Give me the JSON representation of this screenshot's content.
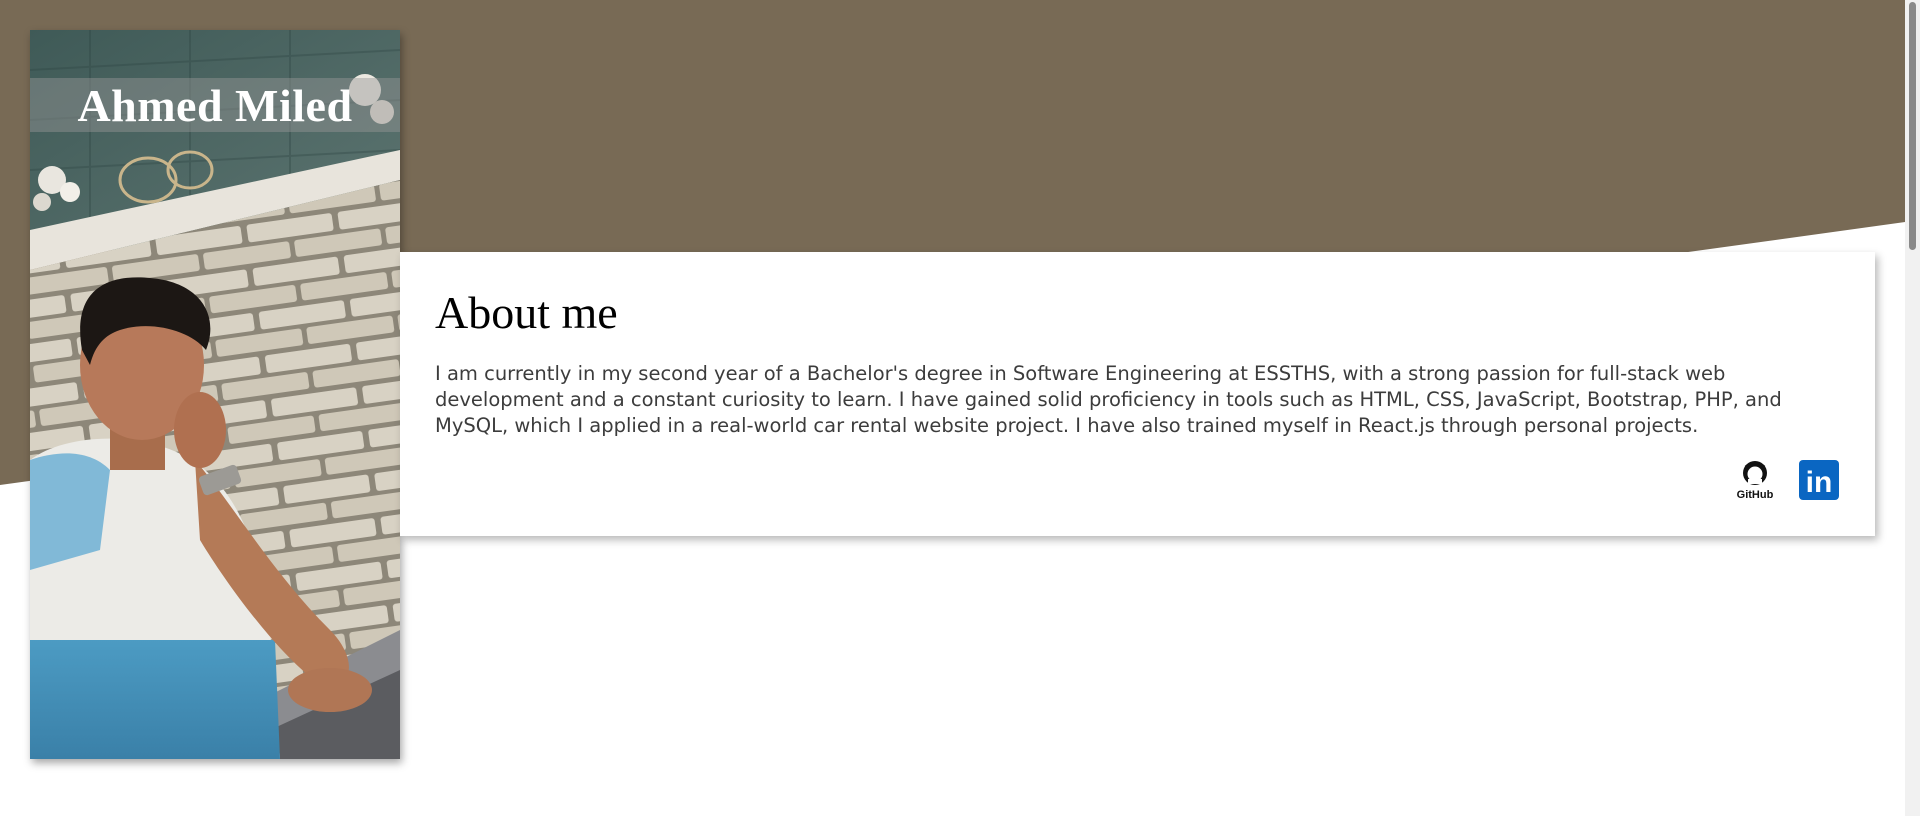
{
  "profile": {
    "name": "Ahmed Miled",
    "photo_icon": "profile-photo"
  },
  "about": {
    "title": "About me",
    "text": "I am currently in my second year of a Bachelor's degree in Software Engineering at ESSTHS, with a strong passion for full-stack web development and a constant curiosity to learn. I have gained solid proficiency in tools such as HTML, CSS, JavaScript, Bootstrap, PHP, and MySQL, which I applied in a real-world car rental website project. I have also trained myself in React.js through personal projects."
  },
  "social": {
    "github": {
      "icon": "github-icon",
      "label": "GitHub"
    },
    "linkedin": {
      "icon": "linkedin-icon",
      "label": "in"
    }
  },
  "colors": {
    "header_bg": "#786a55",
    "page_bg": "#ffffff",
    "linkedin_blue": "#0a66c2",
    "text_dark": "#3c3c3c"
  }
}
